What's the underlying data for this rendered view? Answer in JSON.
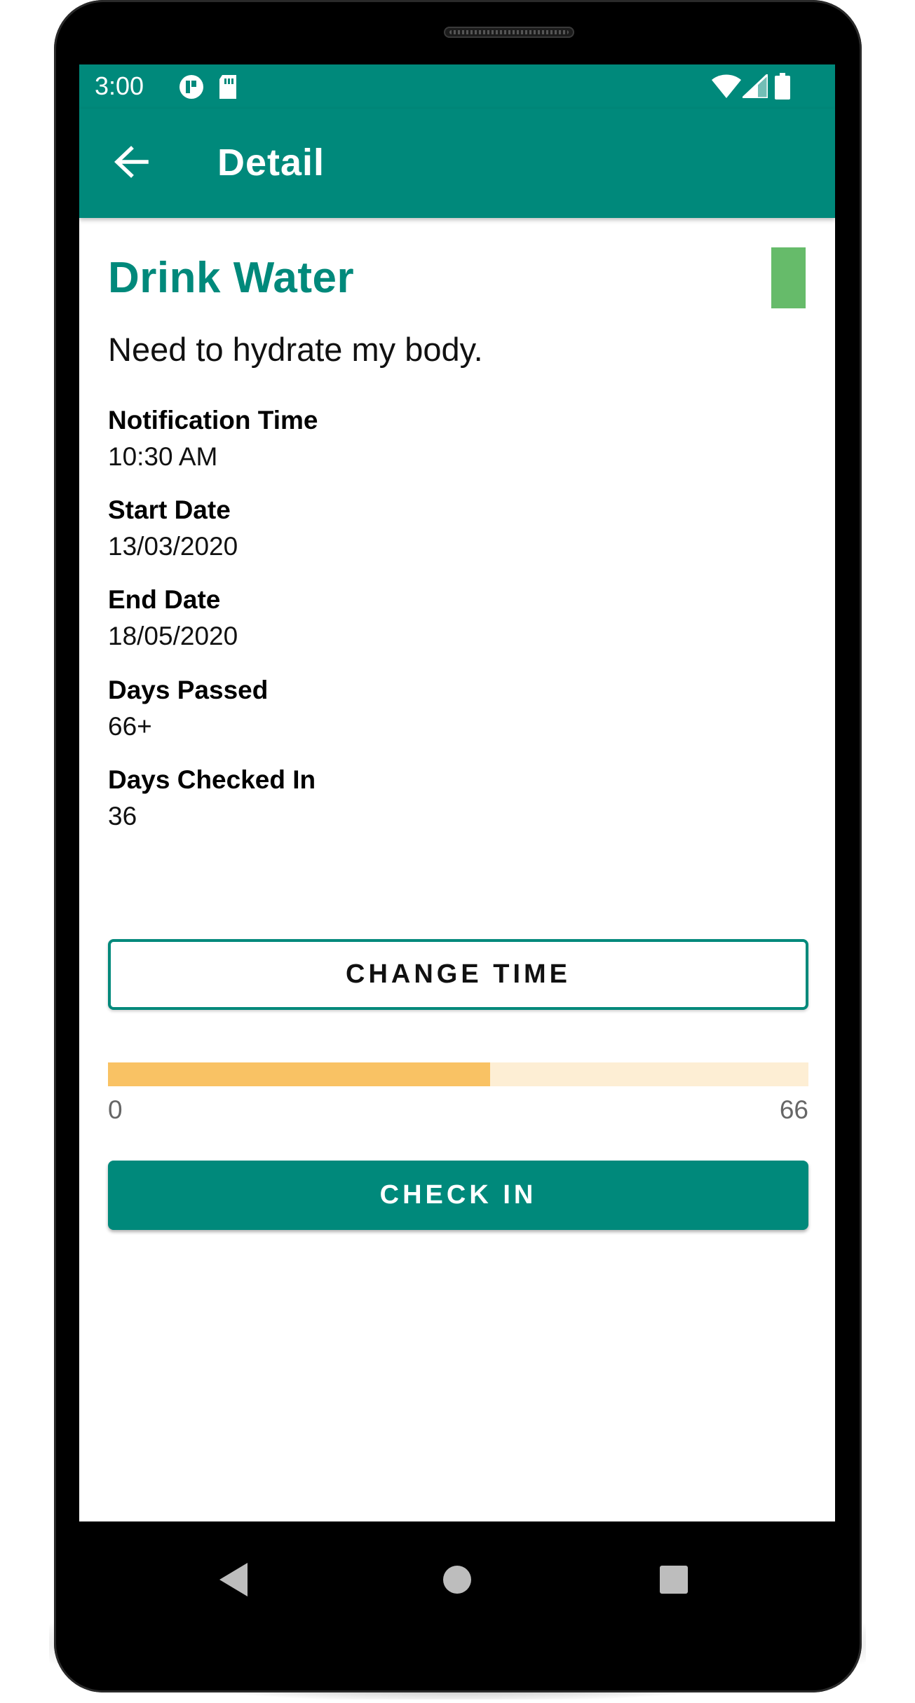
{
  "status_bar": {
    "time": "3:00",
    "icons": [
      "pinwheel-icon",
      "sd-card-icon",
      "wifi-icon",
      "signal-icon",
      "battery-icon"
    ]
  },
  "app_bar": {
    "title": "Detail",
    "back_icon": "arrow-left-icon"
  },
  "habit": {
    "title": "Drink Water",
    "description": "Need to hydrate my body.",
    "color": "#66bb6a",
    "fields": [
      {
        "label": "Notification Time",
        "value": "10:30 AM"
      },
      {
        "label": "Start Date",
        "value": "13/03/2020"
      },
      {
        "label": "End Date",
        "value": "18/05/2020"
      },
      {
        "label": "Days Passed",
        "value": "66+"
      },
      {
        "label": "Days Checked In",
        "value": "36"
      }
    ]
  },
  "actions": {
    "change_time_label": "CHANGE TIME",
    "check_in_label": "CHECK IN"
  },
  "progress": {
    "min_label": "0",
    "max_label": "66",
    "min": 0,
    "max": 66,
    "value": 36,
    "fill_color": "#f9c264",
    "track_color": "#fdeed4"
  },
  "nav_bar": {
    "icons": [
      "back-triangle-icon",
      "home-circle-icon",
      "recents-square-icon"
    ]
  },
  "colors": {
    "accent": "#00897b"
  }
}
